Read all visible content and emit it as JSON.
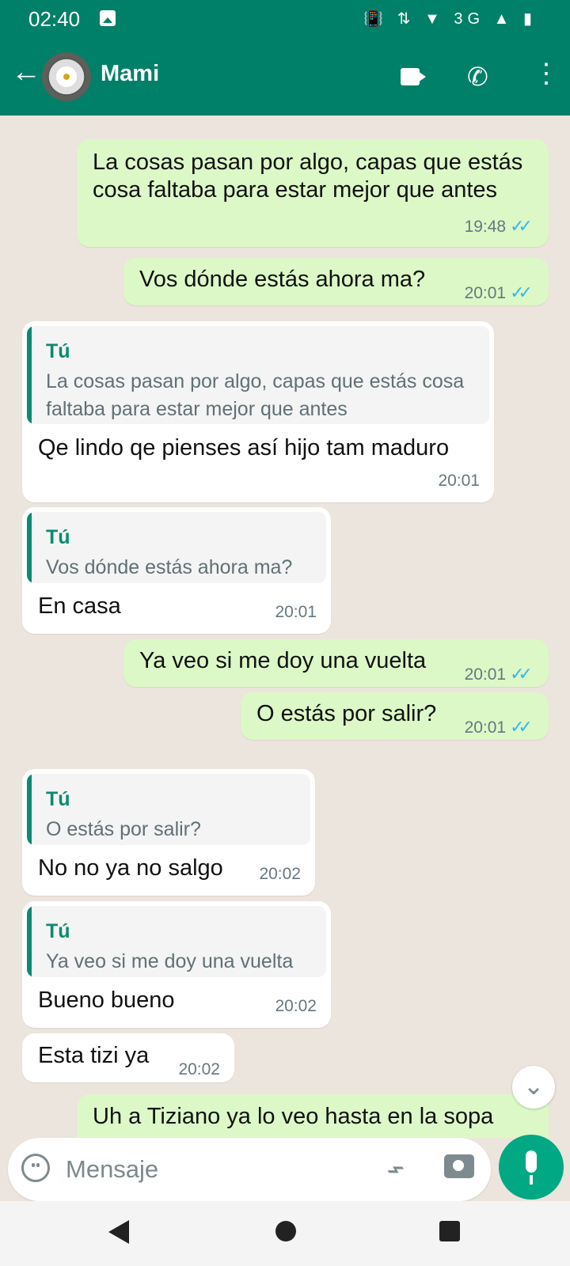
{
  "status": {
    "time": "02:40",
    "icons": "📳 ⇅ ▼ 3G ▲ ▮"
  },
  "contact": {
    "name": "Mami"
  },
  "icons": {
    "back": "arrow-back-icon",
    "video": "video-call-icon",
    "call": "phone-icon",
    "menu": "more-vert-icon",
    "emoji": "emoji-icon",
    "attach": "paperclip-icon",
    "camera": "camera-icon",
    "mic": "mic-icon",
    "scroll": "chevron-down-double-icon"
  },
  "messages": [
    {
      "text": "La cosas pasan por algo, capas que estás cosa faltaba para estar mejor que antes",
      "time": "19:48",
      "checks": "✓✓"
    },
    {
      "text": "Vos dónde estás ahora ma?",
      "time": "20:01",
      "checks": "✓✓"
    },
    {
      "quote_author": "Tú",
      "quote_text": "La cosas pasan por algo, capas que estás cosa faltaba para estar mejor que antes",
      "text": "Qe lindo qe pienses así hijo tam maduro",
      "time": "20:01"
    },
    {
      "quote_author": "Tú",
      "quote_text": "Vos dónde estás ahora ma?",
      "text": "En casa",
      "time": "20:01"
    },
    {
      "text": "Ya veo si me doy una vuelta",
      "time": "20:01",
      "checks": "✓✓"
    },
    {
      "text": "O estás por salir?",
      "time": "20:01",
      "checks": "✓✓"
    },
    {
      "quote_author": "Tú",
      "quote_text": "O estás por salir?",
      "text": "No no ya no salgo",
      "time": "20:02"
    },
    {
      "quote_author": "Tú",
      "quote_text": "Ya veo si me doy una vuelta",
      "text": "Bueno bueno",
      "time": "20:02"
    },
    {
      "text": "Esta tizi ya",
      "time": "20:02"
    },
    {
      "text": "Uh a Tiziano ya lo veo hasta en la sopa"
    }
  ],
  "composer": {
    "placeholder": "Mensaje"
  },
  "colors": {
    "header": "#008069",
    "out_bubble": "#dcf8c6",
    "accent": "#00a884"
  }
}
